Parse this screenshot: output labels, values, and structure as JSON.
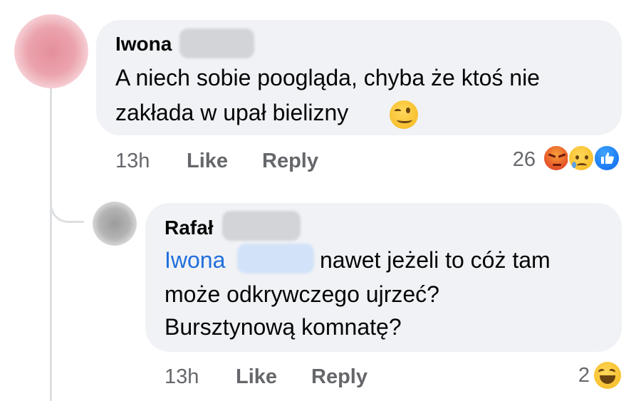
{
  "comment": {
    "author": "Iwona",
    "lines": [
      "A niech sobie poogląda, chyba że ktoś nie",
      "zakłada w upał bielizny"
    ],
    "emoji_icon": "winking-face-icon",
    "time": "13h",
    "like_label": "Like",
    "reply_label": "Reply",
    "reactions_count": "26",
    "reaction_icons": [
      "angry-reaction-icon",
      "sad-reaction-icon",
      "like-reaction-icon"
    ]
  },
  "reply": {
    "author": "Rafał",
    "mention": "Iwona",
    "lines": [
      "nawet jeżeli to cóż tam",
      "może odkrywczego ujrzeć?",
      "Bursztynową komnatę?"
    ],
    "time": "13h",
    "like_label": "Like",
    "reply_label": "Reply",
    "reactions_count": "2",
    "reaction_icons": [
      "haha-reaction-icon"
    ]
  },
  "colors": {
    "bubble": "#f0f2f5",
    "mention": "#216fdb",
    "meta_text": "#65676b",
    "like_blue": "#1877f2"
  }
}
